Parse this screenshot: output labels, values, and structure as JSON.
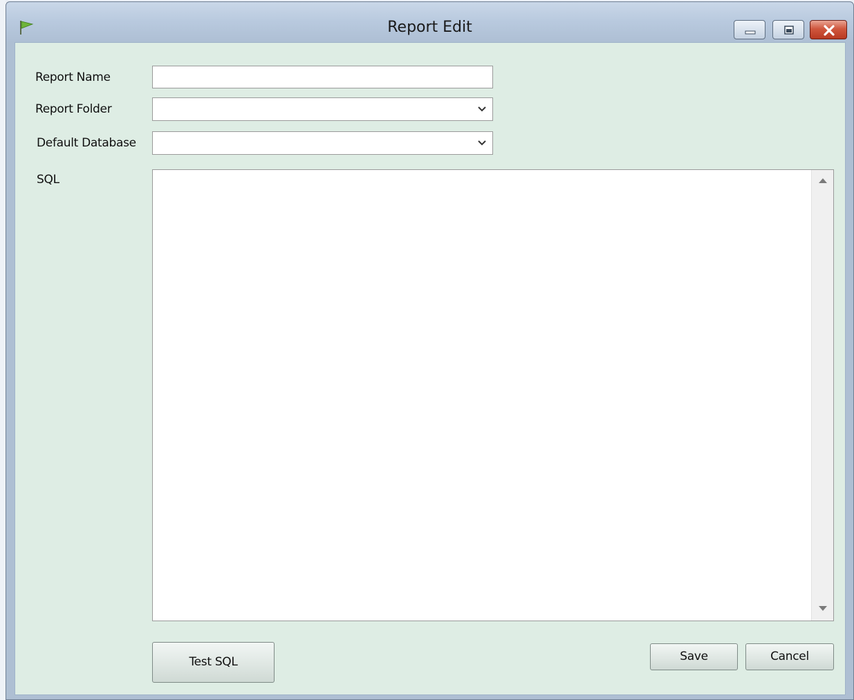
{
  "window": {
    "title": "Report Edit",
    "icon": "green-flag-icon",
    "controls": [
      "minimize-icon",
      "restore-icon",
      "close-icon"
    ]
  },
  "form": {
    "report_name": {
      "label": "Report Name",
      "value": ""
    },
    "report_folder": {
      "label": "Report Folder",
      "selected": ""
    },
    "default_database": {
      "label": "Default Database",
      "selected": ""
    },
    "sql": {
      "label": "SQL",
      "value": ""
    }
  },
  "buttons": {
    "test_sql": "Test SQL",
    "save": "Save",
    "cancel": "Cancel"
  },
  "colors": {
    "client_background": "#deede4",
    "titlebar": "#b8c9de",
    "close_button": "#c9462d"
  }
}
